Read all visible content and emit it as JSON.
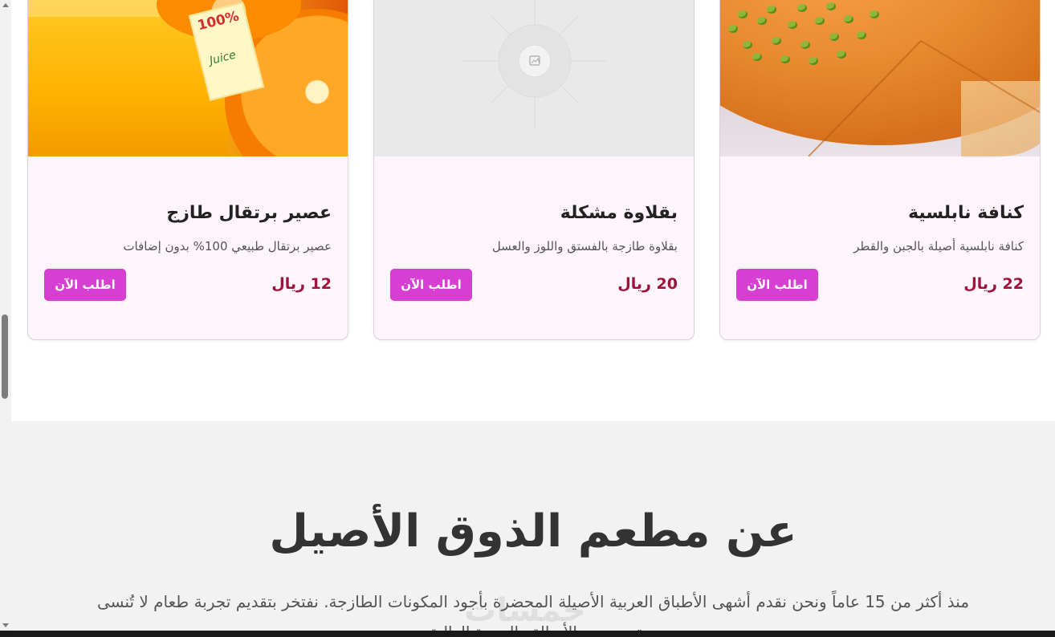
{
  "products": [
    {
      "title": "كنافة نابلسية",
      "description": "كنافة نابلسية أصيلة بالجبن والقطر",
      "price": "22 ريال",
      "order_label": "اطلب الآن",
      "image": "kunafa-photo"
    },
    {
      "title": "بقلاوة مشكلة",
      "description": "بقلاوة طازجة بالفستق واللوز والعسل",
      "price": "20 ريال",
      "order_label": "اطلب الآن",
      "image": "image-placeholder-icon"
    },
    {
      "title": "عصير برتقال طازج",
      "description": "عصير برتقال طبيعي 100% بدون إضافات",
      "price": "12 ريال",
      "order_label": "اطلب الآن",
      "image": "orange-juice-photo",
      "image_text": {
        "tag_top": "100%",
        "tag_bottom": "Juice"
      }
    }
  ],
  "about": {
    "title": "عن مطعم الذوق الأصيل",
    "text": "منذ أكثر من 15 عاماً ونحن نقدم أشهى الأطباق العربية الأصيلة المحضرة بأجود المكونات الطازجة. نفتخر بتقديم تجربة طعام لا تُنسى تجمع بين الأصالة والجودة العالية."
  },
  "watermark": "خمسات",
  "colors": {
    "accent": "#d63fd2",
    "price": "#a0123a",
    "card_bg": "#fdf4fc",
    "section_bg": "#f2f2f3"
  }
}
